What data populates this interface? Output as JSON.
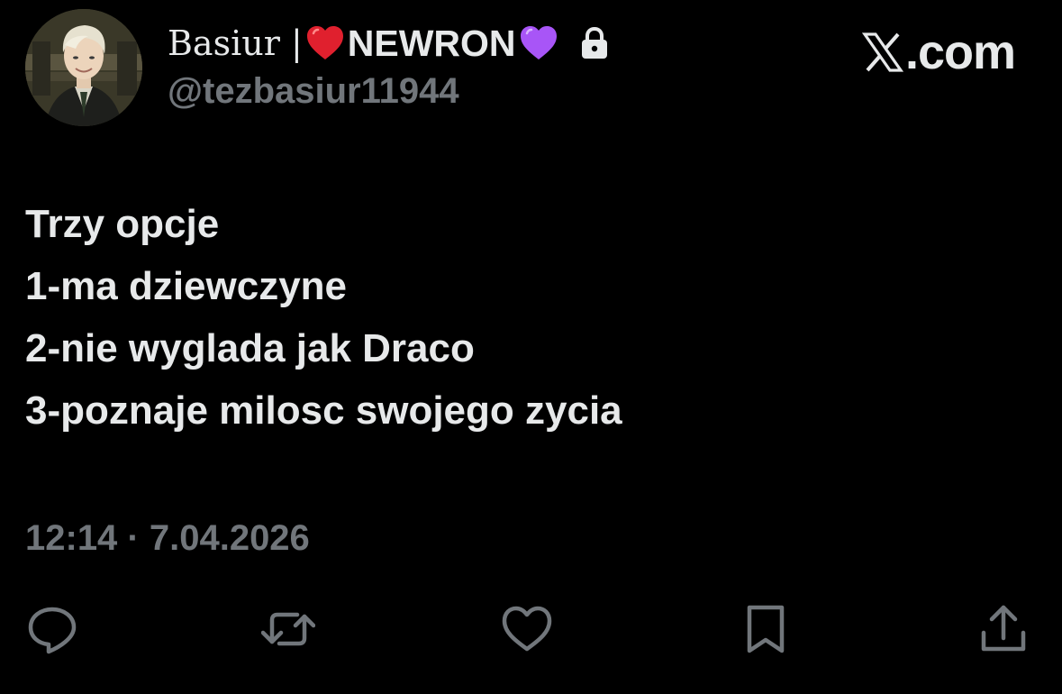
{
  "author": {
    "name_prefix": "Basiur |",
    "name_heart_emoji": "red-heart",
    "name_main": "NEWRON",
    "name_suffix_emoji": "purple-heart",
    "protected_icon": "lock-icon",
    "handle": "@tezbasiur11944",
    "avatar": "profile-photo"
  },
  "watermark": {
    "logo": "x-logo-icon",
    "text": ".com"
  },
  "tweet": {
    "lines": [
      "Trzy opcje",
      "1-ma dziewczyne",
      "2-nie wyglada jak Draco",
      "3-poznaje milosc swojego zycia"
    ],
    "timestamp": "12:14 · 7.04.2026"
  },
  "actions": [
    {
      "name": "reply",
      "icon": "reply-icon"
    },
    {
      "name": "repost",
      "icon": "repost-icon"
    },
    {
      "name": "like",
      "icon": "heart-icon"
    },
    {
      "name": "bookmark",
      "icon": "bookmark-icon"
    },
    {
      "name": "share",
      "icon": "share-icon"
    }
  ],
  "colors": {
    "background": "#000000",
    "primary_text": "#e7e9ea",
    "secondary_text": "#71767b",
    "red_heart": "#e0202e",
    "purple_heart": "#a855f7"
  }
}
